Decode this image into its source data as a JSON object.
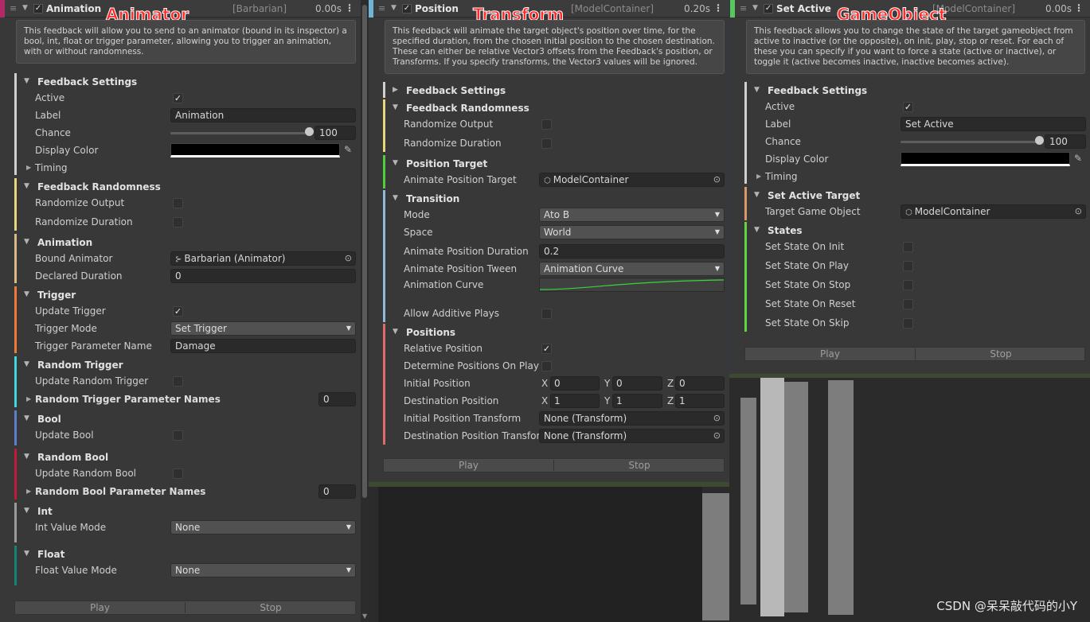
{
  "labels": {
    "animator": "Animator",
    "transform": "Transform",
    "gameobject": "GameObject"
  },
  "watermark": "CSDN @呆呆敲代码的小Y",
  "icons": {
    "check": "✓",
    "fold_open": "▼",
    "fold_closed": "▶",
    "drop": "▼",
    "menu": "⋮",
    "handle": "≡",
    "target": "⊙",
    "eyedropper": "✎",
    "gameobject": "⬡",
    "animator_obj": "⊱"
  },
  "p1": {
    "header": {
      "title": "Animation",
      "bracket": "[Barbarian]",
      "time": "0.00s"
    },
    "description": "This feedback will allow you to send to an animator (bound in its inspector) a bool, int, float or trigger parameter, allowing you to trigger an animation, with or without randomness.",
    "settings": {
      "title": "Feedback Settings",
      "active": "Active",
      "label": "Label",
      "label_value": "Animation",
      "chance": "Chance",
      "chance_value": "100",
      "display_color": "Display Color",
      "timing": "Timing"
    },
    "randomness": {
      "title": "Feedback Randomness",
      "output": "Randomize Output",
      "duration": "Randomize Duration"
    },
    "animation": {
      "title": "Animation",
      "bound": "Bound Animator",
      "bound_value": "Barbarian (Animator)",
      "declared": "Declared Duration",
      "declared_value": "0"
    },
    "trigger": {
      "title": "Trigger",
      "update": "Update Trigger",
      "mode": "Trigger Mode",
      "mode_value": "Set Trigger",
      "param": "Trigger Parameter Name",
      "param_value": "Damage"
    },
    "random_trigger": {
      "title": "Random Trigger",
      "update": "Update Random Trigger",
      "names": "Random Trigger Parameter Names",
      "names_value": "0"
    },
    "bool": {
      "title": "Bool",
      "update": "Update Bool"
    },
    "random_bool": {
      "title": "Random Bool",
      "update": "Update Random Bool",
      "names": "Random Bool Parameter Names",
      "names_value": "0"
    },
    "int": {
      "title": "Int",
      "mode": "Int Value Mode",
      "mode_value": "None"
    },
    "float": {
      "title": "Float",
      "mode": "Float Value Mode",
      "mode_value": "None"
    },
    "play": "Play",
    "stop": "Stop"
  },
  "p2": {
    "header": {
      "title": "Position",
      "bracket": "[ModelContainer]",
      "time": "0.20s"
    },
    "description": "This feedback will animate the target object's position over time, for the specified duration, from the chosen initial position to the chosen destination. These can either be relative Vector3 offsets from the Feedback's position, or Transforms. If you specify transforms, the Vector3 values will be ignored.",
    "settings": {
      "title": "Feedback Settings"
    },
    "randomness": {
      "title": "Feedback Randomness",
      "output": "Randomize Output",
      "duration": "Randomize Duration"
    },
    "target": {
      "title": "Position Target",
      "animate": "Animate Position Target",
      "animate_value": "ModelContainer"
    },
    "transition": {
      "title": "Transition",
      "mode": "Mode",
      "mode_value": "Ato B",
      "space": "Space",
      "space_value": "World",
      "duration": "Animate Position Duration",
      "duration_value": "0.2",
      "tween": "Animate Position Tween",
      "tween_value": "Animation Curve",
      "curve": "Animation Curve",
      "additive": "Allow Additive Plays"
    },
    "positions": {
      "title": "Positions",
      "relative": "Relative Position",
      "determine": "Determine Positions On Play",
      "initial": "Initial Position",
      "initial_xyz": [
        "0",
        "0",
        "0"
      ],
      "destination": "Destination Position",
      "destination_xyz": [
        "1",
        "1",
        "1"
      ],
      "axes": [
        "X",
        "Y",
        "Z"
      ],
      "initial_t": "Initial Position Transform",
      "initial_t_value": "None (Transform)",
      "dest_t": "Destination Position Transform",
      "dest_t_value": "None (Transform)"
    },
    "play": "Play",
    "stop": "Stop"
  },
  "p3": {
    "header": {
      "title": "Set Active",
      "bracket": "[ModelContainer]",
      "time": "0.00s"
    },
    "description": "This feedback allows you to change the state of the target gameobject from active to inactive (or the opposite), on init, play, stop or reset. For each of these you can specify if you want to force a state (active or inactive), or toggle it (active becomes inactive, inactive becomes active).",
    "settings": {
      "title": "Feedback Settings",
      "active": "Active",
      "label": "Label",
      "label_value": "Set Active",
      "chance": "Chance",
      "chance_value": "100",
      "display_color": "Display Color",
      "timing": "Timing"
    },
    "target": {
      "title": "Set Active Target",
      "go": "Target Game Object",
      "go_value": "ModelContainer"
    },
    "states": {
      "title": "States",
      "init": "Set State On Init",
      "play": "Set State On Play",
      "stop": "Set State On Stop",
      "reset": "Set State On Reset",
      "skip": "Set State On Skip"
    },
    "play": "Play",
    "stop": "Stop"
  },
  "colors": {
    "animation_stripe": "#b02a6a",
    "position_stripe": "#6fb6d6",
    "setactive_stripe": "#58c85a",
    "settings": "#cfcfcf",
    "randomness": "#e8d77a",
    "animation_group": "#d9b98a",
    "trigger": "#ef7a3a",
    "random_trigger": "#3fd7df",
    "bool": "#5d7fd0",
    "random_bool": "#c2183a",
    "int": "#9a9a9a",
    "float": "#14847a",
    "position_target": "#4fcf3a",
    "transition": "#8fbbd8",
    "positions": "#e06a6a",
    "setactive_target": "#d99a6a",
    "states": "#61d642",
    "label_red": "#ff2a2a",
    "curve_green": "#36d63a"
  }
}
